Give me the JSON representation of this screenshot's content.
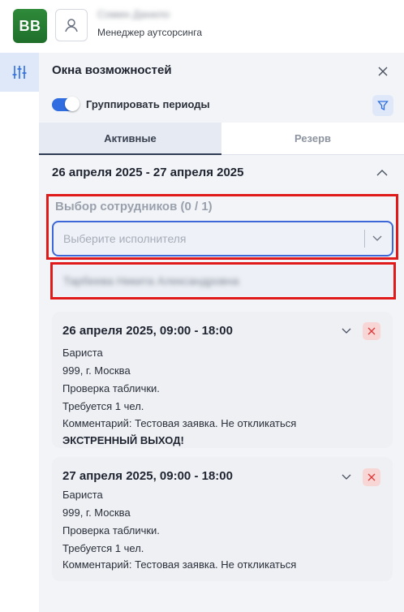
{
  "header": {
    "logo_text": "BB",
    "user_name": "Сомин Данило",
    "user_role": "Менеджер аутсорсинга"
  },
  "panel": {
    "title": "Окна возможностей",
    "group_toggle_label": "Группировать периоды",
    "group_toggle_on": true,
    "tabs": [
      {
        "label": "Активные",
        "active": true
      },
      {
        "label": "Резерв",
        "active": false
      }
    ],
    "period": "26 апреля 2025 - 27 апреля 2025",
    "employees_label": "Выбор сотрудников (0 / 1)",
    "select_placeholder": "Выберите исполнителя",
    "selected_employee": "Тарбеева Никита Александровна"
  },
  "cards": [
    {
      "title": "26 апреля 2025, 09:00 - 18:00",
      "lines": [
        "Бариста",
        "999, г. Москва",
        "Проверка таблички.",
        "Требуется 1 чел.",
        "Комментарий: Тестовая заявка. Не откликаться"
      ],
      "emergency": "ЭКСТРЕННЫЙ ВЫХОД!"
    },
    {
      "title": "27 апреля 2025, 09:00 - 18:00",
      "lines": [
        "Бариста",
        "999, г. Москва",
        "Проверка таблички.",
        "Требуется 1 чел.",
        "Комментарий: Тестовая заявка. Не откликаться"
      ]
    }
  ],
  "colors": {
    "brand": "#1f6f2b",
    "accent": "#2f6de0",
    "highlight_box": "#e0191a",
    "delete_bg": "#f9d6d6"
  }
}
